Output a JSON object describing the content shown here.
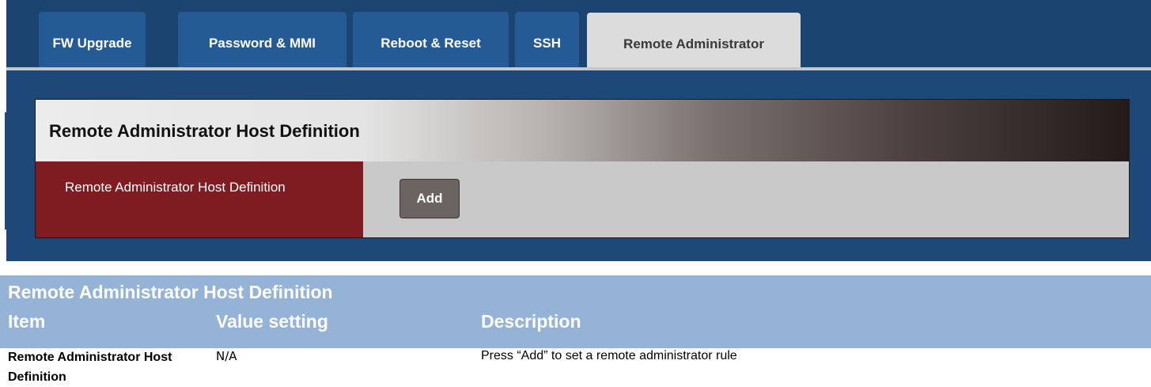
{
  "tabs": [
    {
      "label": "FW Upgrade",
      "active": false
    },
    {
      "label": "Password & MMI",
      "active": false
    },
    {
      "label": "Reboot & Reset",
      "active": false
    },
    {
      "label": "SSH",
      "active": false
    },
    {
      "label": "Remote Administrator",
      "active": true
    }
  ],
  "card": {
    "title": "Remote Administrator Host Definition",
    "row_label": "Remote Administrator Host Definition",
    "add_label": "Add"
  },
  "doc_table": {
    "title": "Remote Administrator Host Definition",
    "headers": {
      "item": "Item",
      "value": "Value setting",
      "description": "Description"
    },
    "rows": [
      {
        "item": "Remote  Administrator Host Definition",
        "value": "N/A",
        "description": "Press “Add” to set a remote administrator rule"
      }
    ]
  },
  "colors": {
    "background": "#1d4877",
    "tab_inactive": "#245b94",
    "tab_active": "#dcdcdc",
    "row_label_bg": "#7f1c21",
    "button": "#6b6461",
    "doc_header": "#95b3d7"
  }
}
